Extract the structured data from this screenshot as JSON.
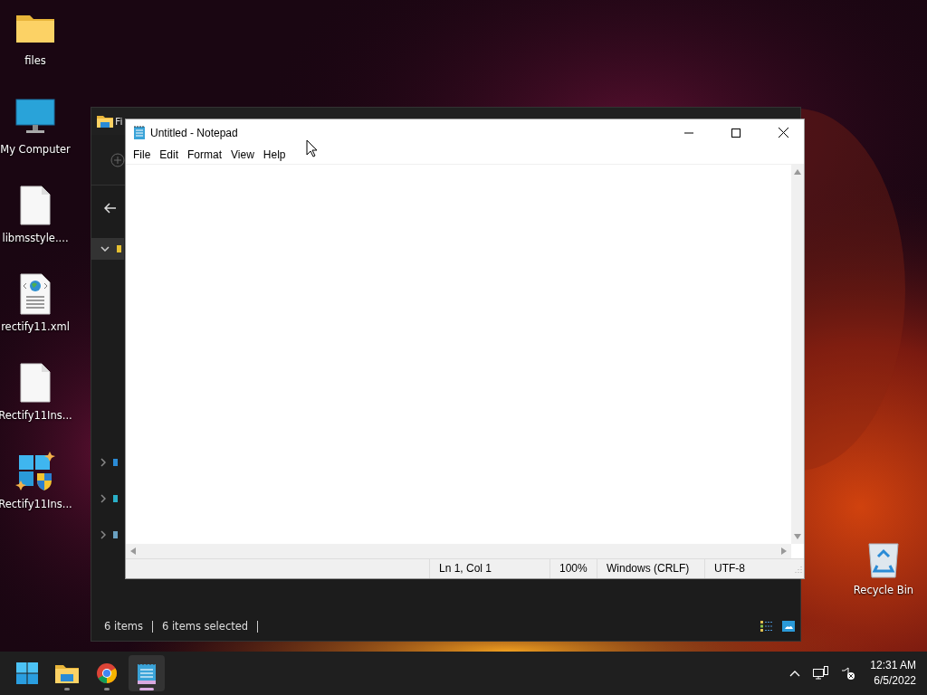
{
  "desktop": {
    "icons": [
      {
        "kind": "folder",
        "label": "files"
      },
      {
        "kind": "monitor",
        "label": "My Computer"
      },
      {
        "kind": "file",
        "label": "libmsstyle...."
      },
      {
        "kind": "xml",
        "label": "rectify11.xml"
      },
      {
        "kind": "file",
        "label": "Rectify11Ins..."
      },
      {
        "kind": "installer",
        "label": "Rectify11Ins..."
      }
    ],
    "recycle_bin": {
      "label": "Recycle Bin"
    }
  },
  "explorer": {
    "title": "Fi",
    "nav_items": [
      {
        "expanded": true,
        "selected": true,
        "color": "#e6c030"
      },
      {
        "expanded": false,
        "selected": false,
        "color": "#2a8bd6"
      },
      {
        "expanded": false,
        "selected": false,
        "color": "#2ab0c8"
      },
      {
        "expanded": false,
        "selected": false,
        "color": "#6aa0c0"
      }
    ],
    "status_items": [
      "6 items",
      "6 items selected"
    ]
  },
  "notepad": {
    "title": "Untitled - Notepad",
    "menu": [
      "File",
      "Edit",
      "Format",
      "View",
      "Help"
    ],
    "status": [
      "Ln 1, Col 1",
      "100%",
      "Windows (CRLF)",
      "UTF-8"
    ]
  },
  "taskbar": {
    "apps": [
      {
        "kind": "start",
        "active": false
      },
      {
        "kind": "explorer",
        "active": false
      },
      {
        "kind": "chrome",
        "active": false
      },
      {
        "kind": "notepad",
        "active": true
      }
    ],
    "time": "12:31 AM",
    "date": "6/5/2022"
  }
}
